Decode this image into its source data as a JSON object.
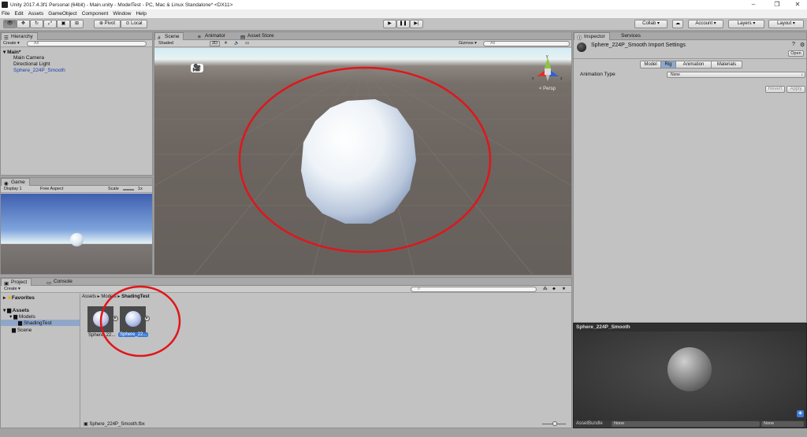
{
  "window": {
    "title": "Unity 2017.4.3f1 Personal (64bit) - Main.unity - ModelTest - PC, Mac & Linux Standalone* <DX11>"
  },
  "menu": [
    "File",
    "Edit",
    "Assets",
    "GameObject",
    "Component",
    "Window",
    "Help"
  ],
  "toolbar": {
    "pivot": "Pivot",
    "local": "Local",
    "collab": "Collab ▾",
    "account": "Account ▾",
    "layers": "Layers ▾",
    "layout": "Layout ▾"
  },
  "hierarchy": {
    "tab": "Hierarchy",
    "create": "Create ▾",
    "search_placeholder": "All",
    "scene": "Main*",
    "items": [
      "Main Camera",
      "Directional Light",
      "Sphere_224P_Smooth"
    ]
  },
  "game": {
    "tab": "Game",
    "display": "Display 1",
    "aspect": "Free Aspect",
    "scale_label": "Scale",
    "scale_value": "1x"
  },
  "scene_view": {
    "tabs": [
      "Scene",
      "Animator",
      "Asset Store"
    ],
    "shading": "Shaded",
    "mode_2d": "2D",
    "gizmos": "Gizmos ▾",
    "search_placeholder": "All",
    "persp": "< Persp",
    "gizmo_axes": [
      "x",
      "y",
      "z"
    ]
  },
  "inspector": {
    "tabs": [
      "Inspector",
      "Services"
    ],
    "title": "Sphere_224P_Smooth Import Settings",
    "open": "Open",
    "subtabs": [
      "Model",
      "Rig",
      "Animation",
      "Materials"
    ],
    "animation_type_label": "Animation Type",
    "animation_type_value": "None",
    "revert": "Revert",
    "apply": "Apply",
    "preview_title": "Sphere_224P_Smooth",
    "assetbundle_label": "AssetBundle",
    "assetbundle_value": "None",
    "assetbundle_variant": "None"
  },
  "project": {
    "tabs": [
      "Project",
      "Console"
    ],
    "create": "Create ▾",
    "favorites": "Favorites",
    "tree": [
      "Assets",
      "Models",
      "ShadingTest",
      "Scene"
    ],
    "breadcrumb": [
      "Assets ▸",
      "Models ▸",
      "ShadingTest"
    ],
    "assets": [
      "Sphere_22...",
      "Sphere_22..."
    ],
    "footer": "Sphere_224P_Smooth.fbx"
  },
  "colors": {
    "annotation": "#e0161b",
    "selection": "#3d7bd9",
    "scene_ground": "#6c6560",
    "sky": "#d6eef6"
  }
}
